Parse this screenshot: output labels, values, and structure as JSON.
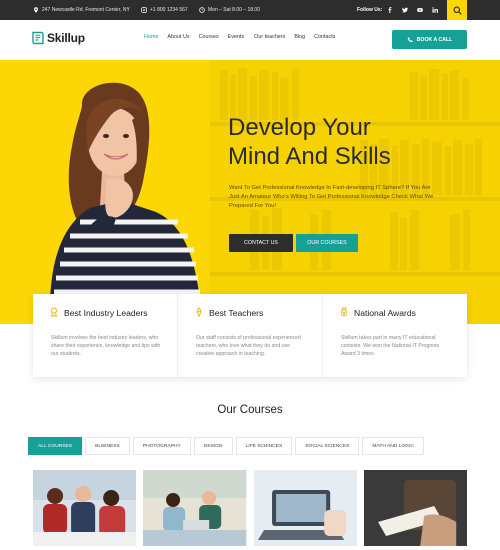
{
  "topbar": {
    "address": "247 Newcastle Rd. Fremont Center, NY",
    "phone": "+1 800 1234 567",
    "hours": "Mon – Sat 8.00 – 18.00",
    "follow_label": "Follow Us:",
    "social": [
      "facebook-icon",
      "twitter-icon",
      "youtube-icon",
      "linkedin-icon",
      "google-plus-icon"
    ]
  },
  "brand": {
    "name": "Skillup",
    "accent": "#16a096",
    "yellow": "#fcd705",
    "dark": "#2d2d2d"
  },
  "nav": {
    "items": [
      "Home",
      "About Us",
      "Courses",
      "Events",
      "Our teachers",
      "Blog",
      "Contacts"
    ],
    "active": "Home",
    "book_label": "BOOK A CALL"
  },
  "hero": {
    "title_line1": "Develop Your",
    "title_line2": "Mind And Skills",
    "text": "Want To Get Professional Knowledge In Fast-developing IT Sphere? If You Are Just An Amateur Who's Willing To Get Professional Knowledge Check What We Prepared For You!",
    "contact_label": "CONTACT US",
    "courses_label": "OUR COURSES"
  },
  "features": [
    {
      "icon": "award-ribbon-icon",
      "title": "Best Industry Leaders",
      "text": "Skillum involves the best industry leaders, who share their experience, knowledge and tips with our students."
    },
    {
      "icon": "pen-icon",
      "title": "Best Teachers",
      "text": "Our staff consists of professional experienced teachers, who love what they do and use creative approach in teaching."
    },
    {
      "icon": "medal-icon",
      "title": "National Awards",
      "text": "Skillum takes part in many IT educational contests. We won the National IT Progress Award 3 times."
    }
  ],
  "courses": {
    "title": "Our Courses",
    "tabs": [
      "ALL COURSES",
      "BUSINESS",
      "PHOTOGRAPHY",
      "DESIGN",
      "LIFE SCIENCES",
      "SOCIAL SCIENCES",
      "MATH AND LOGIC"
    ],
    "active_tab": "ALL COURSES"
  }
}
